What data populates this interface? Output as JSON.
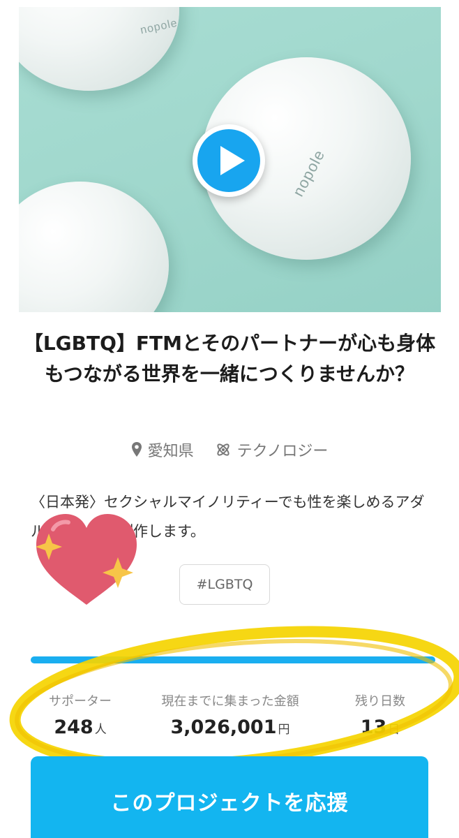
{
  "video": {
    "brand_text": "nopole"
  },
  "project": {
    "title": "【LGBTQ】FTMとそのパートナーが心も身体もつながる世界を一緒につくりませんか？",
    "location": "愛知県",
    "category": "テクノロジー",
    "summary": "〈日本発〉セクシャルマイノリティーでも性を楽しめるアダルトグッズを制作します。",
    "tag": "#LGBTQ"
  },
  "progress": {
    "fraction": 1.0
  },
  "stats": {
    "supporters_label": "サポーター",
    "supporters_value": "248",
    "supporters_unit": "人",
    "amount_label": "現在までに集まった金額",
    "amount_value": "3,026,001",
    "amount_unit": "円",
    "days_label": "残り日数",
    "days_value": "13",
    "days_unit": "日"
  },
  "cta": {
    "support_label": "このプロジェクトを応援"
  },
  "colors": {
    "accent": "#13b5f0",
    "highlight": "#f5d400",
    "heart": "#e05a6e",
    "sparkle": "#f7c548"
  },
  "icons": [
    "play-icon",
    "location-pin-icon",
    "atom-icon",
    "heart-sticker-icon",
    "sparkle-icon"
  ]
}
